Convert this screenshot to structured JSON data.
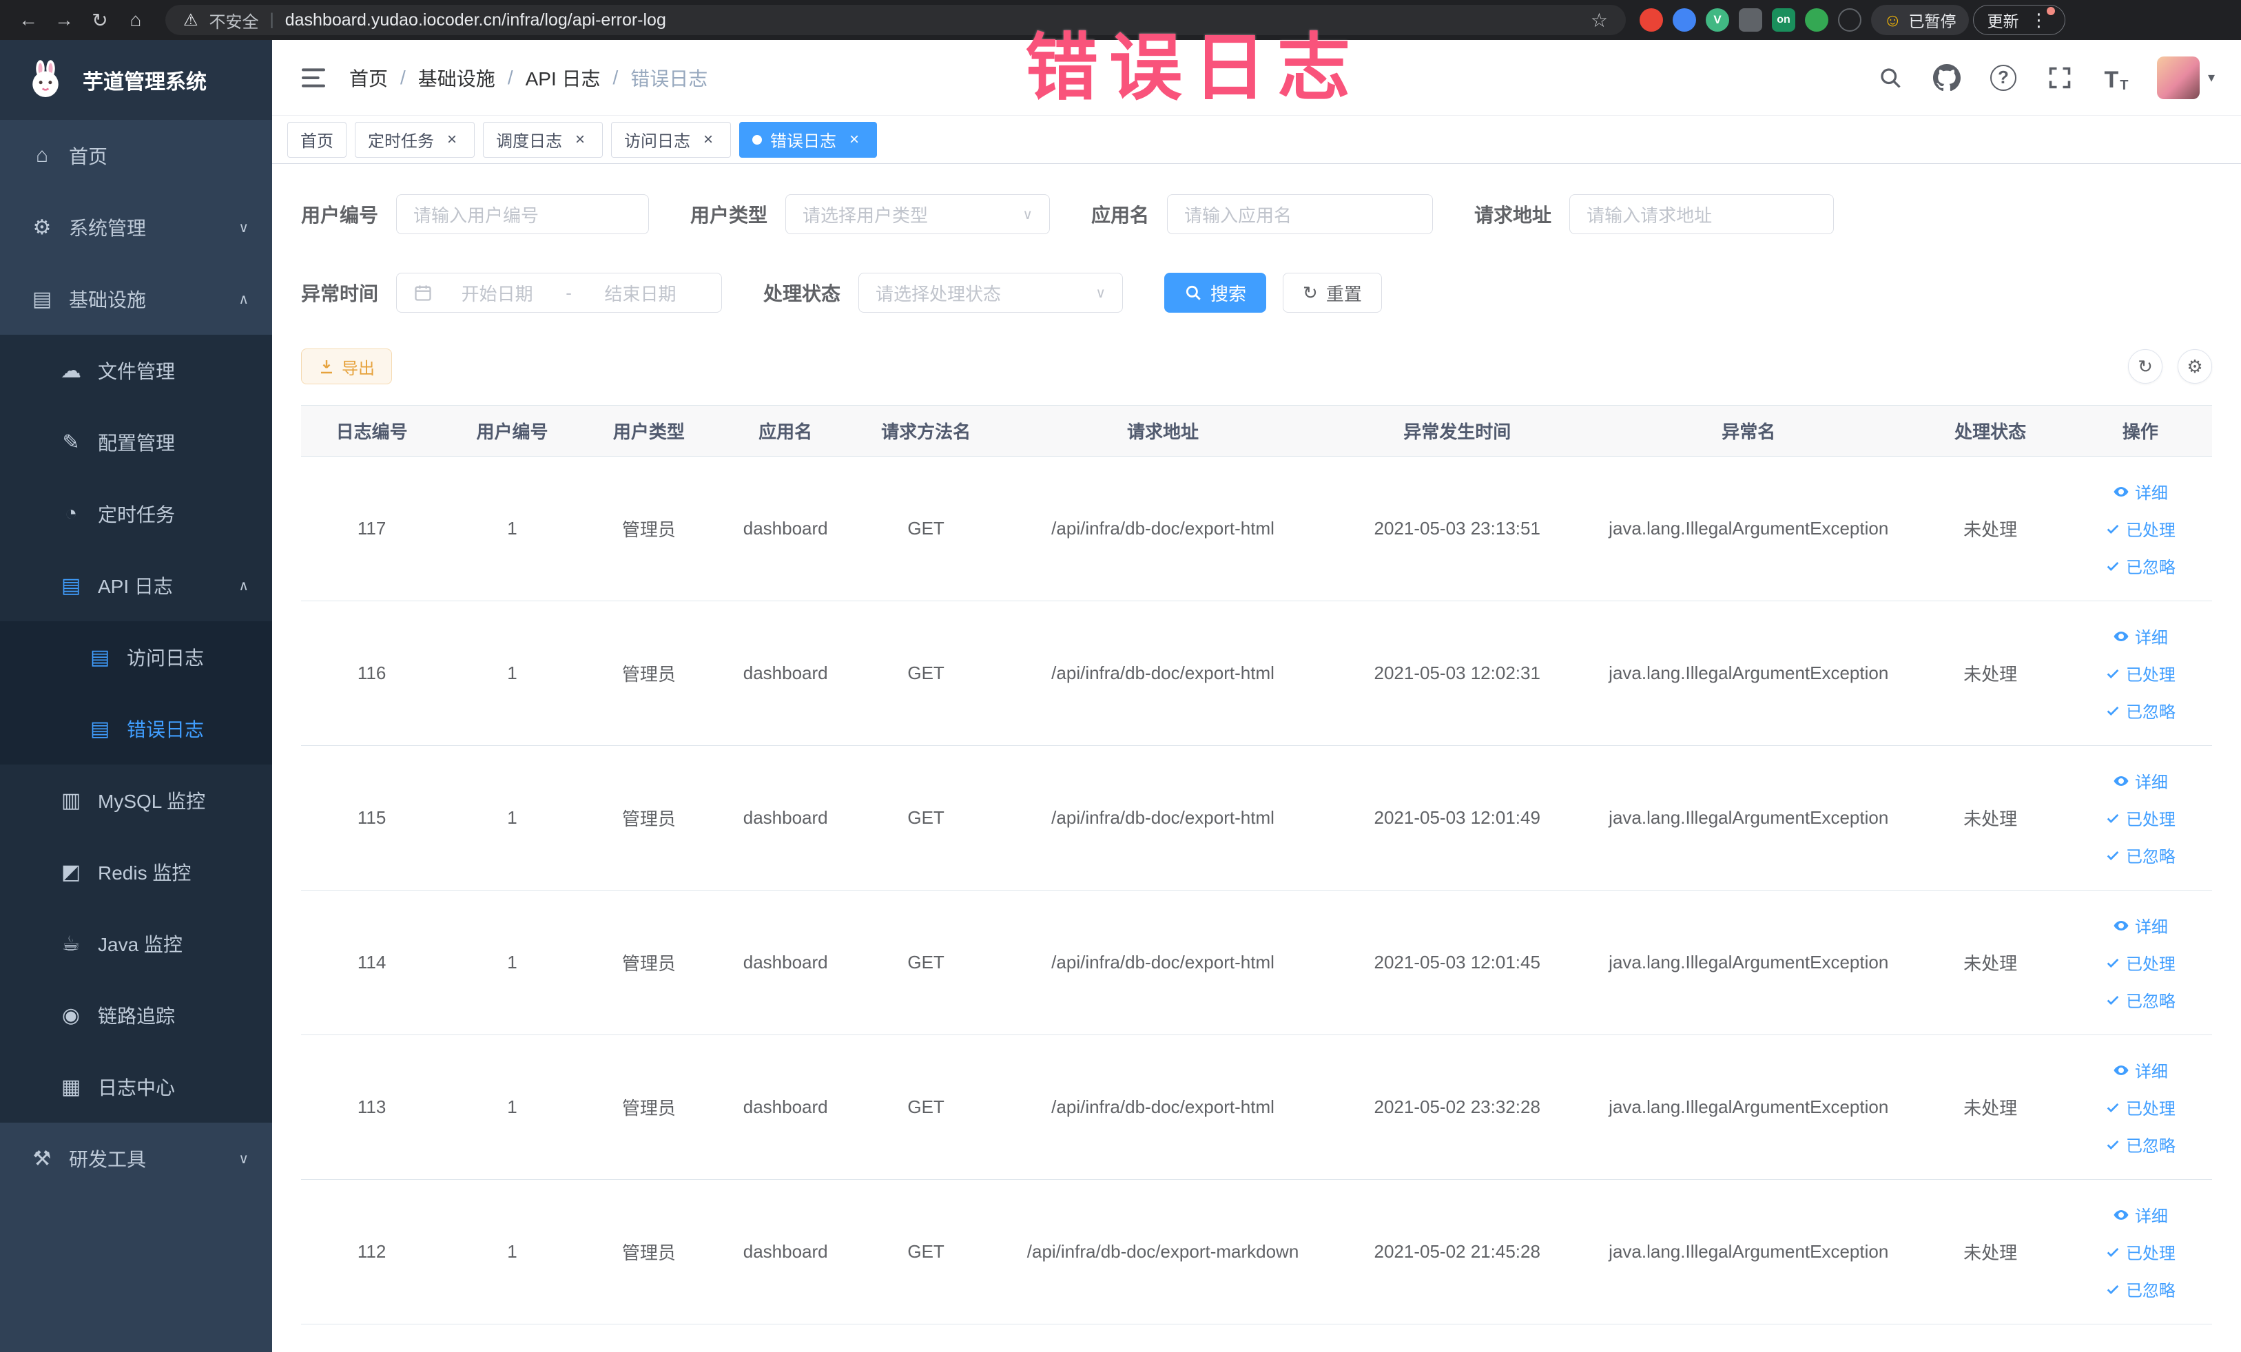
{
  "browser": {
    "security_label": "不安全",
    "url": "dashboard.yudao.iocoder.cn/infra/log/api-error-log",
    "ext_badge": "on",
    "vue_badge": "V",
    "paused_badge": "已暂停",
    "update_label": "更新"
  },
  "annotation": {
    "text": "错误日志"
  },
  "colors": {
    "accent": "#409eff",
    "sidebar": "#304156",
    "warning": "#e6a23c",
    "annotation": "#f9537b"
  },
  "sidebar": {
    "logo_title": "芋道管理系统",
    "items": [
      {
        "name": "home",
        "label": "首页",
        "icon": "home-icon",
        "level": 1
      },
      {
        "name": "system-management",
        "label": "系统管理",
        "icon": "gear-icon",
        "level": 1,
        "arrow": "down"
      },
      {
        "name": "infrastructure",
        "label": "基础设施",
        "icon": "infra-icon",
        "level": 1,
        "arrow": "up"
      },
      {
        "name": "file-management",
        "label": "文件管理",
        "icon": "file-icon",
        "level": 2
      },
      {
        "name": "config-management",
        "label": "配置管理",
        "icon": "config-icon",
        "level": 2
      },
      {
        "name": "scheduled-jobs",
        "label": "定时任务",
        "icon": "job-icon",
        "level": 2
      },
      {
        "name": "api-log",
        "label": "API 日志",
        "icon": "api-log-icon",
        "level": 2,
        "arrow": "up"
      },
      {
        "name": "access-log",
        "label": "访问日志",
        "icon": "doc-icon",
        "level": 3
      },
      {
        "name": "error-log",
        "label": "错误日志",
        "icon": "doc-icon",
        "level": 3,
        "active": true
      },
      {
        "name": "mysql-monitor",
        "label": "MySQL 监控",
        "icon": "mysql-icon",
        "level": 2
      },
      {
        "name": "redis-monitor",
        "label": "Redis 监控",
        "icon": "redis-icon",
        "level": 2
      },
      {
        "name": "java-monitor",
        "label": "Java 监控",
        "icon": "java-icon",
        "level": 2
      },
      {
        "name": "trace",
        "label": "链路追踪",
        "icon": "trace-icon",
        "level": 2
      },
      {
        "name": "log-center",
        "label": "日志中心",
        "icon": "log-center-icon",
        "level": 2
      },
      {
        "name": "dev-tools",
        "label": "研发工具",
        "icon": "tools-icon",
        "level": 1,
        "arrow": "down"
      }
    ]
  },
  "breadcrumb": {
    "items": [
      "首页",
      "基础设施",
      "API 日志",
      "错误日志"
    ]
  },
  "tabs": [
    {
      "name": "home",
      "label": "首页",
      "closable": false,
      "active": false
    },
    {
      "name": "scheduled-jobs",
      "label": "定时任务",
      "closable": true,
      "active": false
    },
    {
      "name": "schedule-log",
      "label": "调度日志",
      "closable": true,
      "active": false
    },
    {
      "name": "access-log",
      "label": "访问日志",
      "closable": true,
      "active": false
    },
    {
      "name": "error-log",
      "label": "错误日志",
      "closable": true,
      "active": true
    }
  ],
  "filters": {
    "user_id": {
      "label": "用户编号",
      "placeholder": "请输入用户编号"
    },
    "user_type": {
      "label": "用户类型",
      "placeholder": "请选择用户类型"
    },
    "app_name": {
      "label": "应用名",
      "placeholder": "请输入应用名"
    },
    "request_url": {
      "label": "请求地址",
      "placeholder": "请输入请求地址"
    },
    "exception_time": {
      "label": "异常时间",
      "start_placeholder": "开始日期",
      "separator": "-",
      "end_placeholder": "结束日期"
    },
    "process_status": {
      "label": "处理状态",
      "placeholder": "请选择处理状态"
    },
    "search_label": "搜索",
    "reset_label": "重置"
  },
  "toolbar": {
    "export_label": "导出"
  },
  "table": {
    "columns": [
      "日志编号",
      "用户编号",
      "用户类型",
      "应用名",
      "请求方法名",
      "请求地址",
      "异常发生时间",
      "异常名",
      "处理状态",
      "操作"
    ],
    "actions": [
      {
        "name": "detail-link",
        "label": "详细",
        "icon": "eye-icon"
      },
      {
        "name": "processed-link",
        "label": "已处理",
        "icon": "check-icon"
      },
      {
        "name": "ignored-link",
        "label": "已忽略",
        "icon": "check-icon"
      }
    ],
    "rows": [
      {
        "id": "117",
        "user_id": "1",
        "user_type": "管理员",
        "app": "dashboard",
        "method": "GET",
        "url": "/api/infra/db-doc/export-html",
        "time": "2021-05-03 23:13:51",
        "exception": "java.lang.IllegalArgumentException",
        "status": "未处理"
      },
      {
        "id": "116",
        "user_id": "1",
        "user_type": "管理员",
        "app": "dashboard",
        "method": "GET",
        "url": "/api/infra/db-doc/export-html",
        "time": "2021-05-03 12:02:31",
        "exception": "java.lang.IllegalArgumentException",
        "status": "未处理"
      },
      {
        "id": "115",
        "user_id": "1",
        "user_type": "管理员",
        "app": "dashboard",
        "method": "GET",
        "url": "/api/infra/db-doc/export-html",
        "time": "2021-05-03 12:01:49",
        "exception": "java.lang.IllegalArgumentException",
        "status": "未处理"
      },
      {
        "id": "114",
        "user_id": "1",
        "user_type": "管理员",
        "app": "dashboard",
        "method": "GET",
        "url": "/api/infra/db-doc/export-html",
        "time": "2021-05-03 12:01:45",
        "exception": "java.lang.IllegalArgumentException",
        "status": "未处理"
      },
      {
        "id": "113",
        "user_id": "1",
        "user_type": "管理员",
        "app": "dashboard",
        "method": "GET",
        "url": "/api/infra/db-doc/export-html",
        "time": "2021-05-02 23:32:28",
        "exception": "java.lang.IllegalArgumentException",
        "status": "未处理"
      },
      {
        "id": "112",
        "user_id": "1",
        "user_type": "管理员",
        "app": "dashboard",
        "method": "GET",
        "url": "/api/infra/db-doc/export-markdown",
        "time": "2021-05-02 21:45:28",
        "exception": "java.lang.IllegalArgumentException",
        "status": "未处理"
      }
    ]
  }
}
